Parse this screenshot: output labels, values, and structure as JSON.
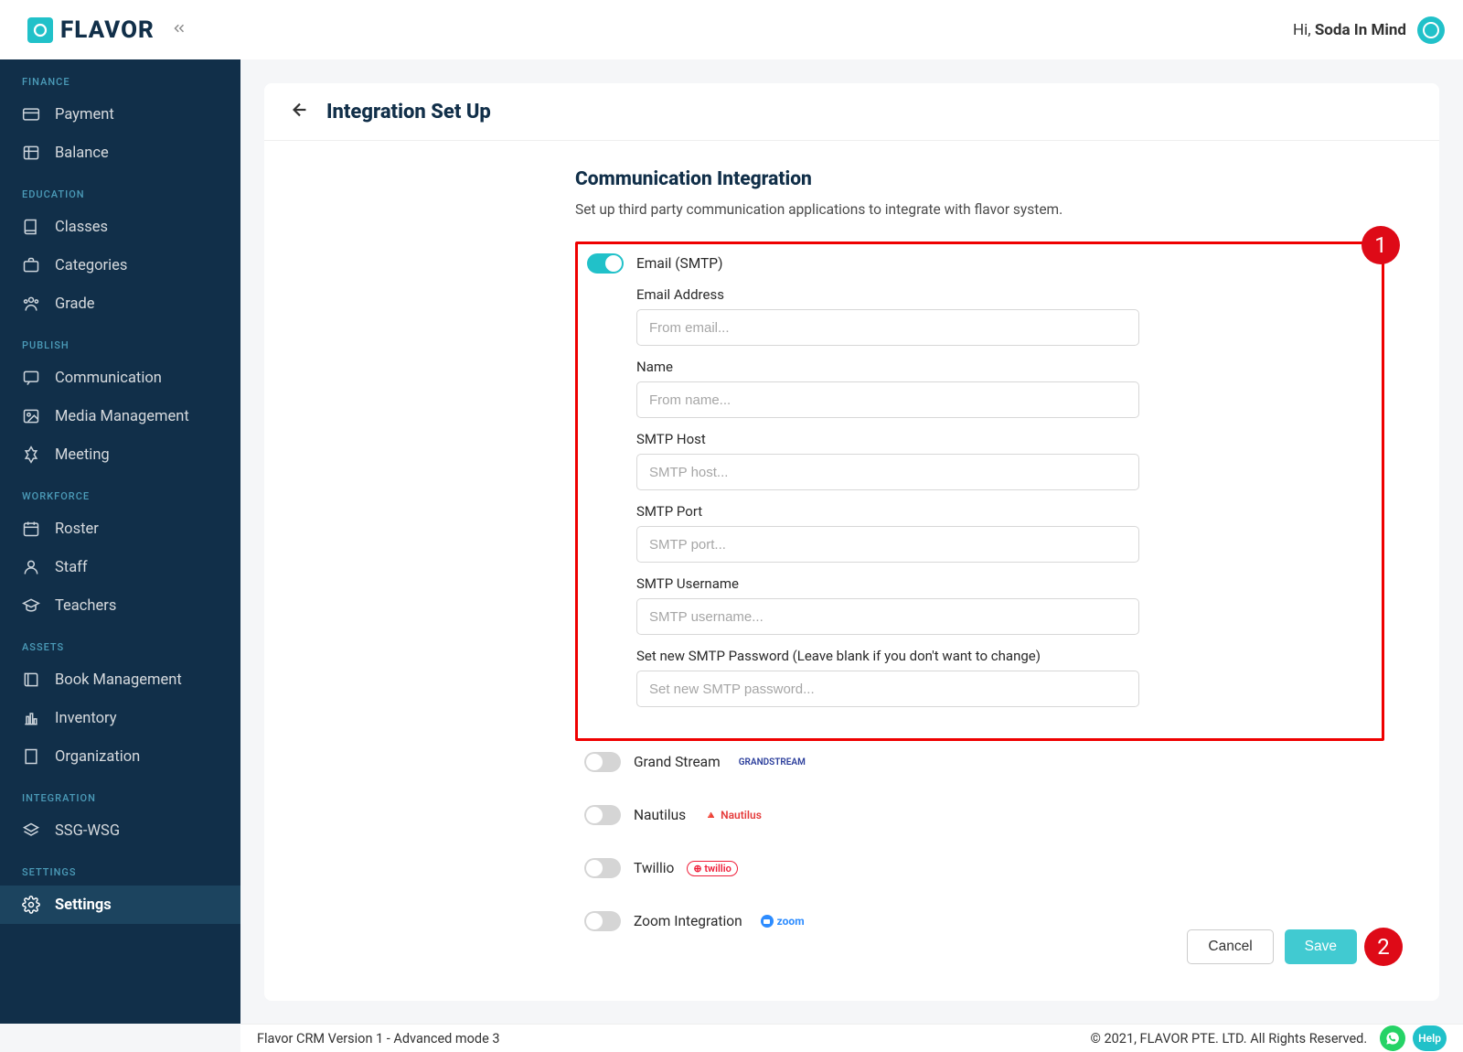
{
  "brand": "FLAVOR",
  "header": {
    "greeting_prefix": "Hi, ",
    "username": "Soda In Mind"
  },
  "page": {
    "title": "Integration Set Up",
    "section_title": "Communication Integration",
    "section_desc": "Set up third party communication applications to integrate with flavor system."
  },
  "sidebar": {
    "groups": [
      {
        "label": "FINANCE",
        "items": [
          {
            "label": "Payment",
            "icon": "credit-card-icon"
          },
          {
            "label": "Balance",
            "icon": "table-icon"
          }
        ]
      },
      {
        "label": "EDUCATION",
        "items": [
          {
            "label": "Classes",
            "icon": "book-icon"
          },
          {
            "label": "Categories",
            "icon": "briefcase-icon"
          },
          {
            "label": "Grade",
            "icon": "people-icon"
          }
        ]
      },
      {
        "label": "PUBLISH",
        "items": [
          {
            "label": "Communication",
            "icon": "chat-icon"
          },
          {
            "label": "Media Management",
            "icon": "image-icon"
          },
          {
            "label": "Meeting",
            "icon": "video-icon"
          }
        ]
      },
      {
        "label": "WORKFORCE",
        "items": [
          {
            "label": "Roster",
            "icon": "calendar-icon"
          },
          {
            "label": "Staff",
            "icon": "person-icon"
          },
          {
            "label": "Teachers",
            "icon": "grad-icon"
          }
        ]
      },
      {
        "label": "ASSETS",
        "items": [
          {
            "label": "Book Management",
            "icon": "book2-icon"
          },
          {
            "label": "Inventory",
            "icon": "chart-icon"
          },
          {
            "label": "Organization",
            "icon": "building-icon"
          }
        ]
      },
      {
        "label": "INTEGRATION",
        "items": [
          {
            "label": "SSG-WSG",
            "icon": "layers-icon"
          }
        ]
      },
      {
        "label": "SETTINGS",
        "items": [
          {
            "label": "Settings",
            "icon": "gear-icon",
            "active": true
          }
        ]
      }
    ]
  },
  "smtp": {
    "toggle_label": "Email (SMTP)",
    "fields": {
      "email_address": {
        "label": "Email Address",
        "placeholder": "From email..."
      },
      "name": {
        "label": "Name",
        "placeholder": "From name..."
      },
      "host": {
        "label": "SMTP Host",
        "placeholder": "SMTP host..."
      },
      "port": {
        "label": "SMTP Port",
        "placeholder": "SMTP port..."
      },
      "username": {
        "label": "SMTP Username",
        "placeholder": "SMTP username..."
      },
      "password": {
        "label": "Set new SMTP Password (Leave blank if you don't want to change)",
        "placeholder": "Set new SMTP password..."
      }
    }
  },
  "other_integrations": [
    {
      "label": "Grand Stream",
      "brand": "GRANDSTREAM"
    },
    {
      "label": "Nautilus",
      "brand": "Nautilus"
    },
    {
      "label": "Twillio",
      "brand": "twillio"
    },
    {
      "label": "Zoom Integration",
      "brand": "zoom"
    }
  ],
  "buttons": {
    "cancel": "Cancel",
    "save": "Save"
  },
  "footer": {
    "version": "Flavor CRM Version 1 - Advanced mode 3",
    "copyright": "© 2021, FLAVOR PTE. LTD. All Rights Reserved.",
    "help": "Help"
  },
  "annotations": {
    "box1": "1",
    "box2": "2"
  }
}
